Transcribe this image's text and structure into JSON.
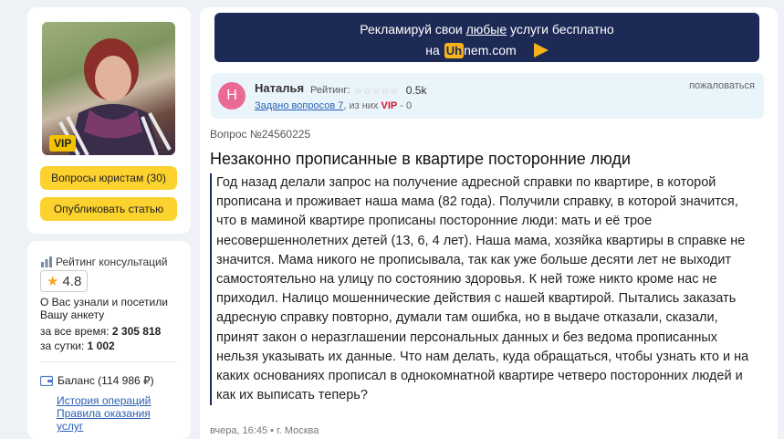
{
  "profile": {
    "vip_badge": "VIP",
    "questions_button": "Вопросы юристам (30)",
    "publish_button": "Опубликовать статью"
  },
  "rating": {
    "title": "Рейтинг консультаций",
    "value": "4.8",
    "known_text": "О Вас узнали и посетили Вашу анкету",
    "all_time_label": "за все время:",
    "all_time_value": "2 305 818",
    "day_label": "за сутки:",
    "day_value": "1 002"
  },
  "balance": {
    "label": "Баланс (114 986 ₽)",
    "history_link": "История операций",
    "services_link": "Правила оказания услуг"
  },
  "promo": {
    "line1_before": "Рекламируй свои",
    "line1_link": "любые",
    "line1_after": "услуги бесплатно",
    "line2_prefix": "на",
    "brand_highlight": "Uh",
    "brand_rest": "nem.com"
  },
  "author": {
    "initial": "Н",
    "name": "Наталья",
    "rating_label": "Рейтинг:",
    "stars": "☆☆☆☆☆",
    "score": "0.5k",
    "complain": "пожаловаться",
    "asked_link": "Задано вопросов 7",
    "asked_mid": ", из них",
    "asked_vip": "VIP",
    "asked_count": "- 0"
  },
  "question": {
    "number": "Вопрос №24560225",
    "title": "Незаконно прописанные в квартире посторонние люди",
    "body": "Год назад делали запрос на получение адресной справки по квартире, в которой прописана и проживает наша мама (82 года). Получили справку, в которой значится, что в маминой квартире прописаны посторонние люди: мать и её трое несовершеннолетних детей (13, 6, 4 лет). Наша мама, хозяйка квартиры в справке не значится. Мама никого не прописывала, так как уже больше десяти лет не выходит самостоятельно на улицу по состоянию здоровья. К ней тоже никто кроме нас не приходил. Налицо мошеннические действия с нашей квартирой. Пытались заказать адресную справку повторно, думали там ошибка, но в выдаче отказали, сказали, принят закон о неразглашении персональных данных и без ведома прописанных нельзя указывать их данные. Что нам делать, куда обращаться, чтобы узнать кто и на каких основаниях прописал в однокомнатной квартире четверо посторонних людей и как их выписать теперь?",
    "meta": "вчера, 16:45 • г. Москва"
  },
  "colors": {
    "accent_yellow": "#fcd22e",
    "promo_bg": "#1d2a55",
    "link": "#2a5fb3",
    "vip_red": "#d4142a"
  }
}
